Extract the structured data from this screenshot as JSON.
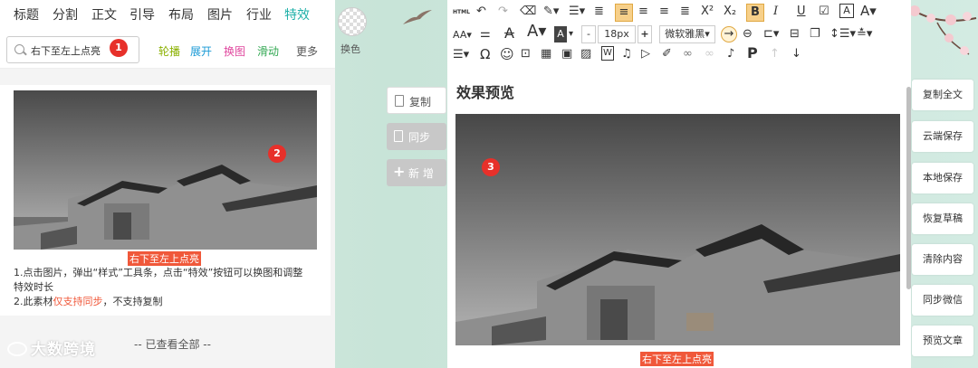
{
  "nav": {
    "items": [
      "标题",
      "分割",
      "正文",
      "引导",
      "布局",
      "图片",
      "行业",
      "特效"
    ],
    "active_index": 7,
    "swap_label": "换色"
  },
  "subbar": {
    "search_value": "右下至左上点亮",
    "items": [
      {
        "label": "轮播",
        "color": "#8ab000"
      },
      {
        "label": "展开",
        "color": "#1a9ad6"
      },
      {
        "label": "换图",
        "color": "#e0479e"
      },
      {
        "label": "滑动",
        "color": "#32a852"
      },
      {
        "label": "更多",
        "color": "#555555"
      }
    ]
  },
  "badges": [
    "1",
    "2",
    "3"
  ],
  "material": {
    "caption": "右下至左上点亮",
    "desc_line1": "1.点击图片，弹出“样式”工具条，点击“特效”按钮可以换图和调整",
    "desc_line2": "特效时长",
    "desc_line3_pre": "2.此素材",
    "desc_line3_hl": "仅支持同步",
    "desc_line3_post": "，不支持复制"
  },
  "footer": {
    "viewed_all": "-- 已查看全部 --",
    "logo": "大数跨境"
  },
  "mid_buttons": {
    "copy": "复制",
    "sync": "同步",
    "new": "新 增"
  },
  "toolbar": {
    "html": "HTML",
    "font_size": "18px",
    "font_family": "微软雅黑"
  },
  "editor": {
    "title": "效果预览",
    "caption": "右下至左上点亮"
  },
  "right_buttons": [
    "复制全文",
    "云端保存",
    "本地保存",
    "恢复草稿",
    "清除内容",
    "同步微信",
    "预览文章"
  ],
  "colors": {
    "accent": "#1fb0a8",
    "badge": "#e7302a",
    "caption_bg": "#f0583a",
    "highlight_btn": "#f7d08a"
  }
}
